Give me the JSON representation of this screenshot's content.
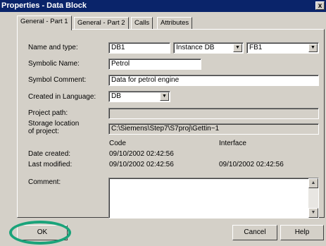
{
  "window": {
    "title": "Properties - Data Block",
    "close_glyph": "x"
  },
  "tabs": [
    {
      "label": "General - Part 1"
    },
    {
      "label": "General - Part 2"
    },
    {
      "label": "Calls"
    },
    {
      "label": "Attributes"
    }
  ],
  "form": {
    "name_type": {
      "label": "Name and type:",
      "name": "DB1",
      "type": "Instance DB",
      "fb": "FB1"
    },
    "symbolic_name": {
      "label": "Symbolic Name:",
      "value": "Petrol"
    },
    "symbol_comment": {
      "label": "Symbol Comment:",
      "value": "Data for petrol engine"
    },
    "created_lang": {
      "label": "Created in Language:",
      "value": "DB"
    },
    "project_path": {
      "label": "Project path:",
      "value": ""
    },
    "storage": {
      "label_line1": "Storage location",
      "label_line2": "of project:",
      "value": "C:\\Siemens\\Step7\\S7proj\\Gettin~1"
    },
    "columns": {
      "code": "Code",
      "interface": "Interface"
    },
    "date_created": {
      "label": "Date created:",
      "code": "09/10/2002  02:42:56"
    },
    "last_modified": {
      "label": "Last modified:",
      "code": "09/10/2002  02:42:56",
      "interface": "09/10/2002  02:42:56"
    },
    "comment": {
      "label": "Comment:",
      "value": ""
    }
  },
  "buttons": {
    "ok": "OK",
    "cancel": "Cancel",
    "help": "Help"
  },
  "colors": {
    "highlight_ring": "#1aa37a",
    "titlebar": "#0a246a"
  }
}
